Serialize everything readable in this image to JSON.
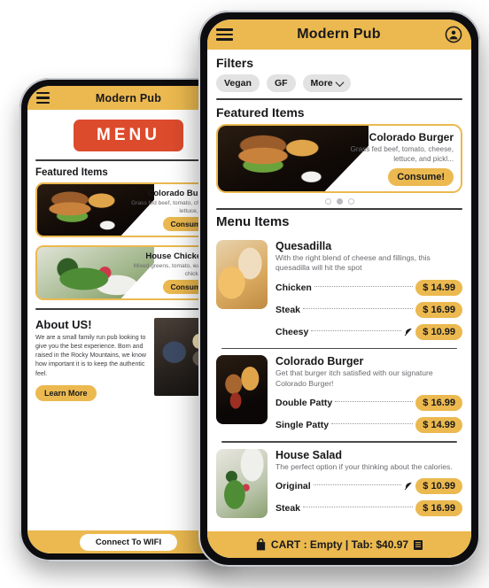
{
  "front_phone": {
    "header": {
      "title": "Modern Pub",
      "menu_icon": "hamburger-icon",
      "account_icon": "account-circle-icon"
    },
    "filters": {
      "title": "Filters",
      "chips": [
        {
          "label": "Vegan"
        },
        {
          "label": "GF"
        },
        {
          "label": "More"
        }
      ]
    },
    "featured": {
      "title": "Featured Items",
      "card": {
        "name": "Colorado Burger",
        "description": "Grass fed beef, tomato, cheese, lettuce, and pickl...",
        "button": "Consume!",
        "image": "burger-photo"
      },
      "pagination": {
        "count": 3,
        "active_index": 1
      }
    },
    "menu": {
      "title": "Menu Items",
      "items": [
        {
          "name": "Quesadilla",
          "description": "With the right blend of cheese and fillings, this quesadilla will hit the spot",
          "image": "quesadilla-photo",
          "options": [
            {
              "label": "Chicken",
              "price": "$ 14.99",
              "vegan": false
            },
            {
              "label": "Steak",
              "price": "$ 16.99",
              "vegan": false
            },
            {
              "label": "Cheesy",
              "price": "$ 10.99",
              "vegan": true
            }
          ]
        },
        {
          "name": "Colorado Burger",
          "description": "Get that burger itch satisfied with our signature Colorado Burger!",
          "image": "burger-photo",
          "options": [
            {
              "label": "Double Patty",
              "price": "$ 16.99",
              "vegan": false
            },
            {
              "label": "Single Patty",
              "price": "$ 14.99",
              "vegan": false
            }
          ]
        },
        {
          "name": "House Salad",
          "description": "The perfect option if your thinking about the calories.",
          "image": "salad-photo",
          "options": [
            {
              "label": "Original",
              "price": "$ 10.99",
              "vegan": true
            },
            {
              "label": "Steak",
              "price": "$ 16.99",
              "vegan": false
            }
          ]
        }
      ]
    },
    "bottom_bar": {
      "cart_icon": "shopping-bag-icon",
      "text": "CART : Empty | Tab: $40.97",
      "receipt_icon": "receipt-icon"
    }
  },
  "back_phone": {
    "header": {
      "title": "Modern Pub",
      "menu_icon": "hamburger-icon"
    },
    "menu_button": "MENU",
    "featured": {
      "title": "Featured Items",
      "cards": [
        {
          "name": "Colorado Burger",
          "description": "Grass fed beef, tomato, cheese, lettuce, and p",
          "button": "Consume!",
          "image": "burger-photo"
        },
        {
          "name": "House Chicken S",
          "description": "Mixed greens, tomato, walnuts, chicken, an",
          "button": "Consume!",
          "image": "salad-photo"
        }
      ]
    },
    "about": {
      "title": "About US!",
      "text": "We are a small family run pub looking to give you the best experience. Born and raised in the Rocky Mountains, we know how important it is to keep the authentic feel.",
      "button": "Learn More",
      "image": "kitchen-photo"
    },
    "bottom_bar": {
      "wifi_button": "Connect To WIFI"
    }
  },
  "colors": {
    "accent_yellow": "#ebb94f",
    "menu_red": "#dd4b2d",
    "chip_gray": "#e2e2e2",
    "text_dark": "#18181b"
  }
}
